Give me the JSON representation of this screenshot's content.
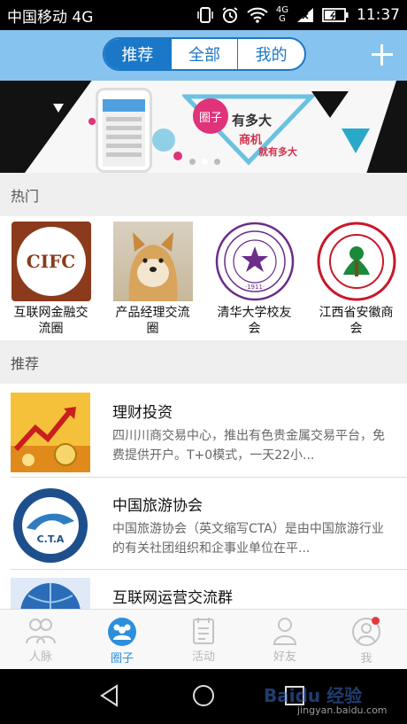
{
  "status_bar": {
    "carrier": "中国移动 4G",
    "network_top": "4G",
    "network_bottom": "G",
    "time": "11:37"
  },
  "header": {
    "tabs": [
      {
        "label": "推荐",
        "active": true
      },
      {
        "label": "全部",
        "active": false
      },
      {
        "label": "我的",
        "active": false
      }
    ],
    "add_icon": "plus-icon"
  },
  "banner": {
    "badge": "圈子",
    "text_big": "有多大",
    "text_small1": "商机",
    "text_small2": "就有多大",
    "dot_count": 3,
    "active_dot": 2
  },
  "hot_section": {
    "title": "热门",
    "items": [
      {
        "label": "互联网金融交流圈",
        "thumb_text": "CIFC"
      },
      {
        "label": "产品经理交流圈"
      },
      {
        "label": "清华大学校友会",
        "thumb_text": "·1911·"
      },
      {
        "label": "江西省安徽商会"
      }
    ]
  },
  "recommend_section": {
    "title": "推荐",
    "items": [
      {
        "title": "理财投资",
        "desc": "四川川商交易中心，推出有色贵金属交易平台，免费提供开户。T+0模式，一天22小..."
      },
      {
        "title": "中国旅游协会",
        "desc": "中国旅游协会（英文缩写CTA）是由中国旅游行业的有关社团组织和企事业单位在平...",
        "thumb_text": "C.T.A"
      },
      {
        "title": "互联网运营交流群",
        "desc": ""
      }
    ]
  },
  "tab_bar": {
    "tabs": [
      {
        "label": "人脉",
        "icon": "people-icon",
        "active": false
      },
      {
        "label": "圈子",
        "icon": "circle-group-icon",
        "active": true
      },
      {
        "label": "活动",
        "icon": "calendar-icon",
        "active": false
      },
      {
        "label": "好友",
        "icon": "person-icon",
        "active": false
      },
      {
        "label": "我",
        "icon": "profile-icon",
        "active": false,
        "badge": true
      }
    ]
  },
  "watermark": {
    "text": "Baidu 经验",
    "sub": "jingyan.baidu.com"
  },
  "colors": {
    "primary": "#1b77c7",
    "header_bg": "#86c3ee",
    "active_tab": "#2c8fdc",
    "badge_red": "#e4393c"
  }
}
